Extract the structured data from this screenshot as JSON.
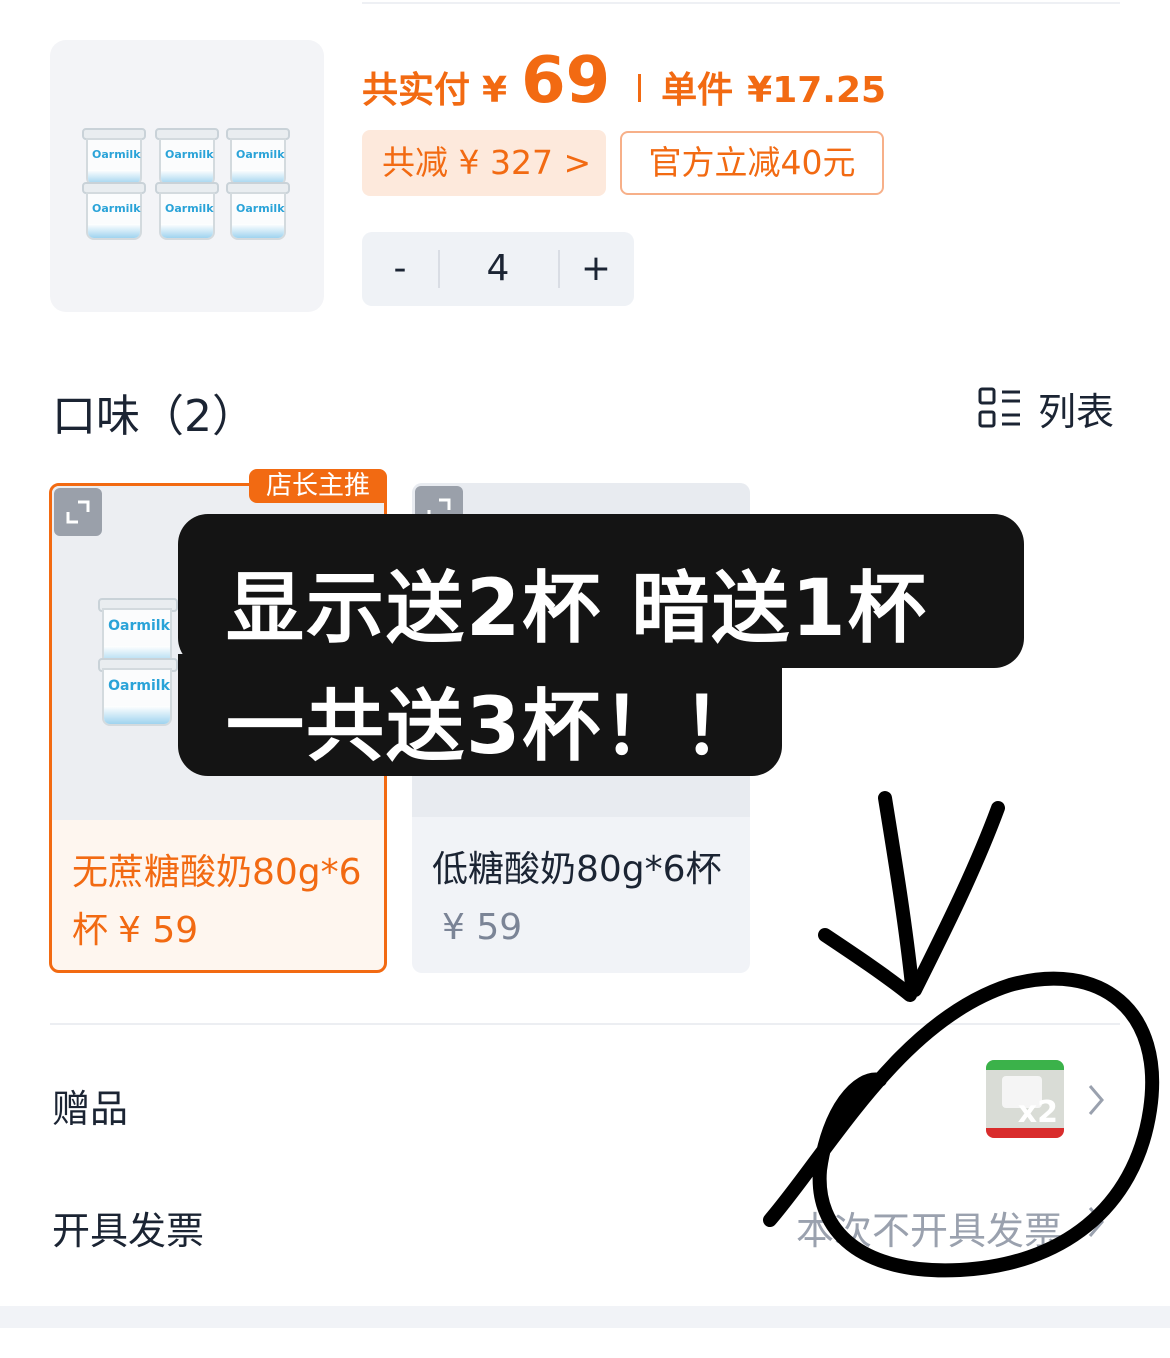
{
  "product": {
    "brand_text": "Oarmilk",
    "price_label": "共实付",
    "currency": "¥",
    "price": "69",
    "unit_label": "单件",
    "unit_price": "¥17.25",
    "saving_text": "共减 ¥ 327 >",
    "official_discount": "官方立减40元",
    "stepper": {
      "minus": "-",
      "quantity": "4",
      "plus": "+"
    }
  },
  "flavors": {
    "title": "口味（2）",
    "view_toggle_label": "列表",
    "view_toggle_icon": "list-view-icon",
    "options": [
      {
        "name": "无蔗糖酸奶80g*6杯",
        "price": "¥ 59",
        "badge": "店长主推",
        "selected": true
      },
      {
        "name": "低糖酸奶80g*6杯",
        "price": "¥ 59",
        "selected": false
      }
    ]
  },
  "overlay_caption": {
    "line1": "显示送2杯 暗送1杯",
    "line2": "一共送3杯！！"
  },
  "gift_row": {
    "label": "赠品",
    "count": "x2",
    "chevron_icon": "chevron-right-icon"
  },
  "invoice_row": {
    "label": "开具发票",
    "value": "本次不开具发票",
    "chevron_icon": "chevron-right-icon"
  },
  "colors": {
    "accent": "#f26a12",
    "text": "#1b2433",
    "muted": "#9aa1ae"
  }
}
